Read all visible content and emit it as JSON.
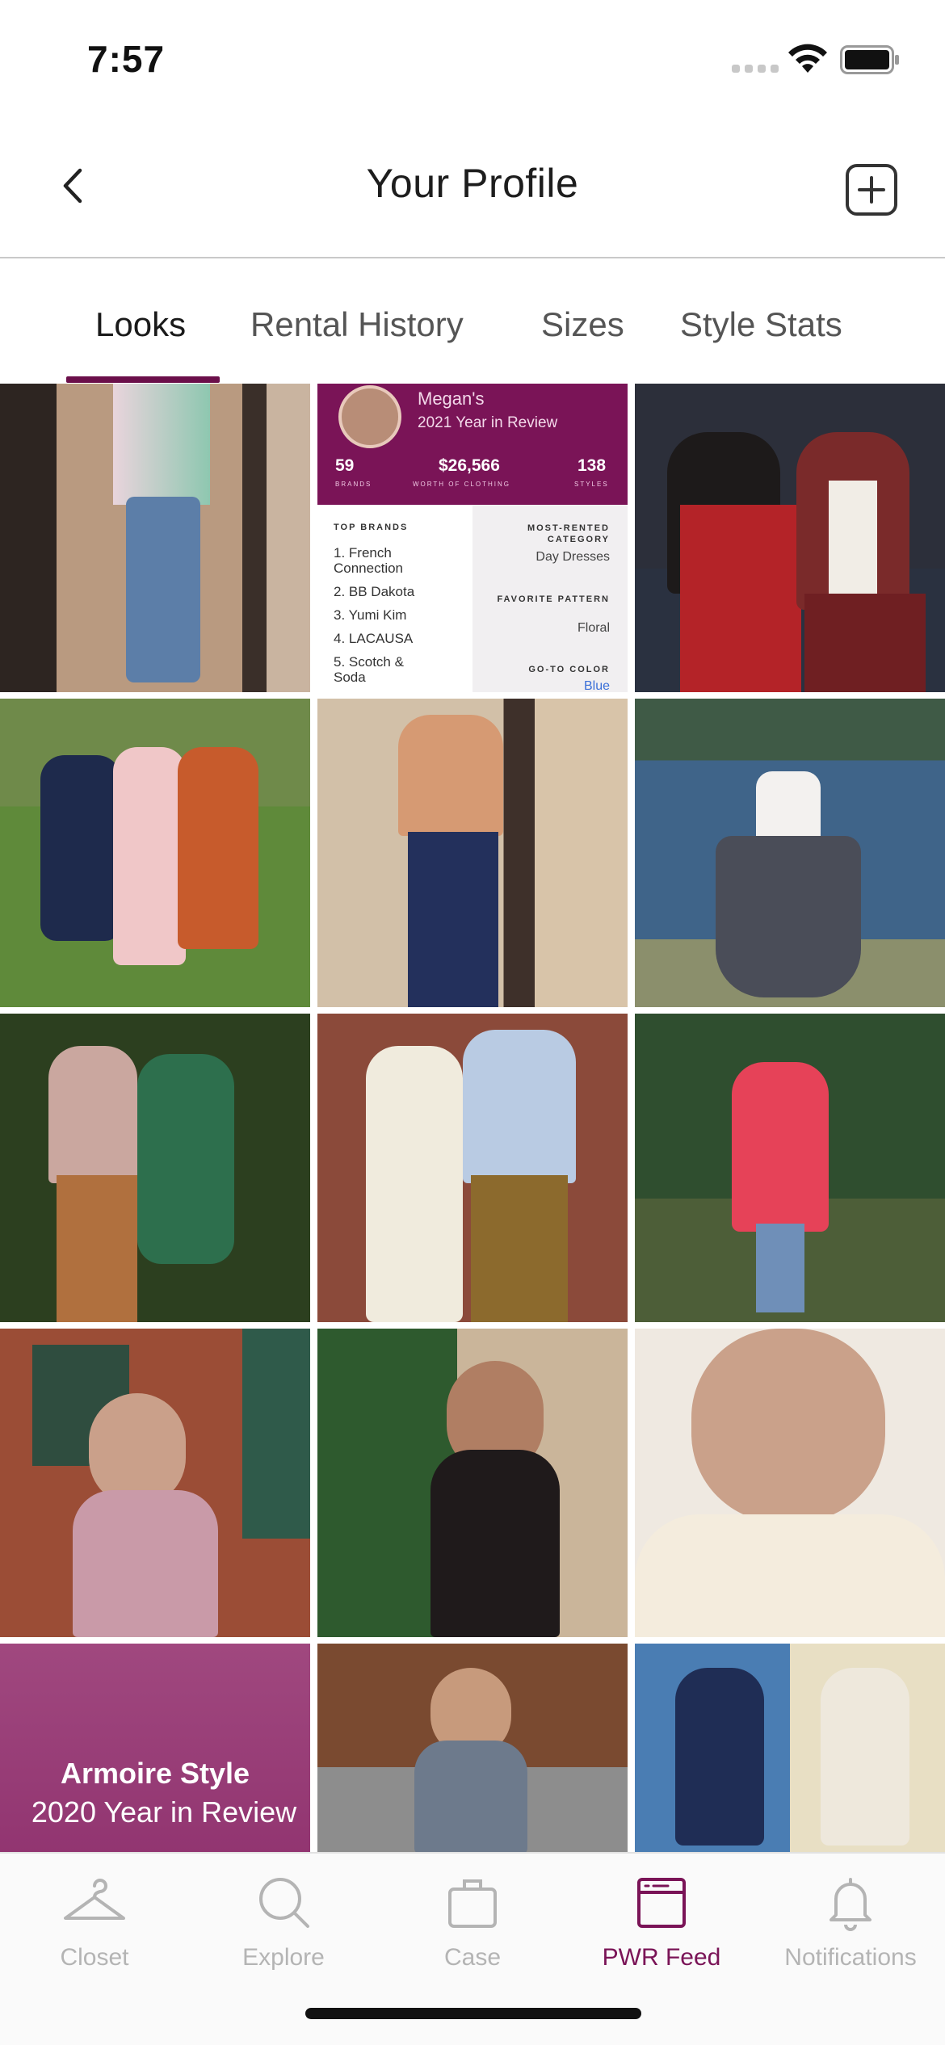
{
  "status_bar": {
    "time": "7:57"
  },
  "header": {
    "title": "Your Profile"
  },
  "tabs": [
    {
      "label": "Looks",
      "active": true
    },
    {
      "label": "Rental History",
      "active": false
    },
    {
      "label": "Sizes",
      "active": false
    },
    {
      "label": "Style Stats",
      "active": false
    }
  ],
  "year_in_review": {
    "name": "Megan's",
    "subtitle": "2021 Year in Review",
    "stats": [
      {
        "value": "59",
        "label": "BRANDS"
      },
      {
        "value": "$26,566",
        "label": "WORTH OF CLOTHING"
      },
      {
        "value": "138",
        "label": "STYLES"
      }
    ],
    "top_brands_heading": "TOP BRANDS",
    "top_brands": [
      "1. French Connection",
      "2. BB Dakota",
      "3. Yumi Kim",
      "4. LACAUSA",
      "5. Scotch & Soda"
    ],
    "most_rented_heading": "MOST-RENTED CATEGORY",
    "most_rented": "Day Dresses",
    "favorite_pattern_heading": "FAVORITE PATTERN",
    "favorite_pattern": "Floral",
    "go_to_color_heading": "GO-TO COLOR",
    "go_to_color": "Blue"
  },
  "armoire_card": {
    "title": "Armoire Style",
    "subtitle": "2020 Year in Review"
  },
  "tab_bar": [
    {
      "label": "Closet",
      "icon": "hanger-icon",
      "active": false
    },
    {
      "label": "Explore",
      "icon": "search-icon",
      "active": false
    },
    {
      "label": "Case",
      "icon": "case-icon",
      "active": false
    },
    {
      "label": "PWR Feed",
      "icon": "feed-icon",
      "active": true
    },
    {
      "label": "Notifications",
      "icon": "bell-icon",
      "active": false
    }
  ],
  "colors": {
    "accent": "#7a1457",
    "inactive": "#b4b4b4",
    "divider": "#c9c9c9"
  }
}
